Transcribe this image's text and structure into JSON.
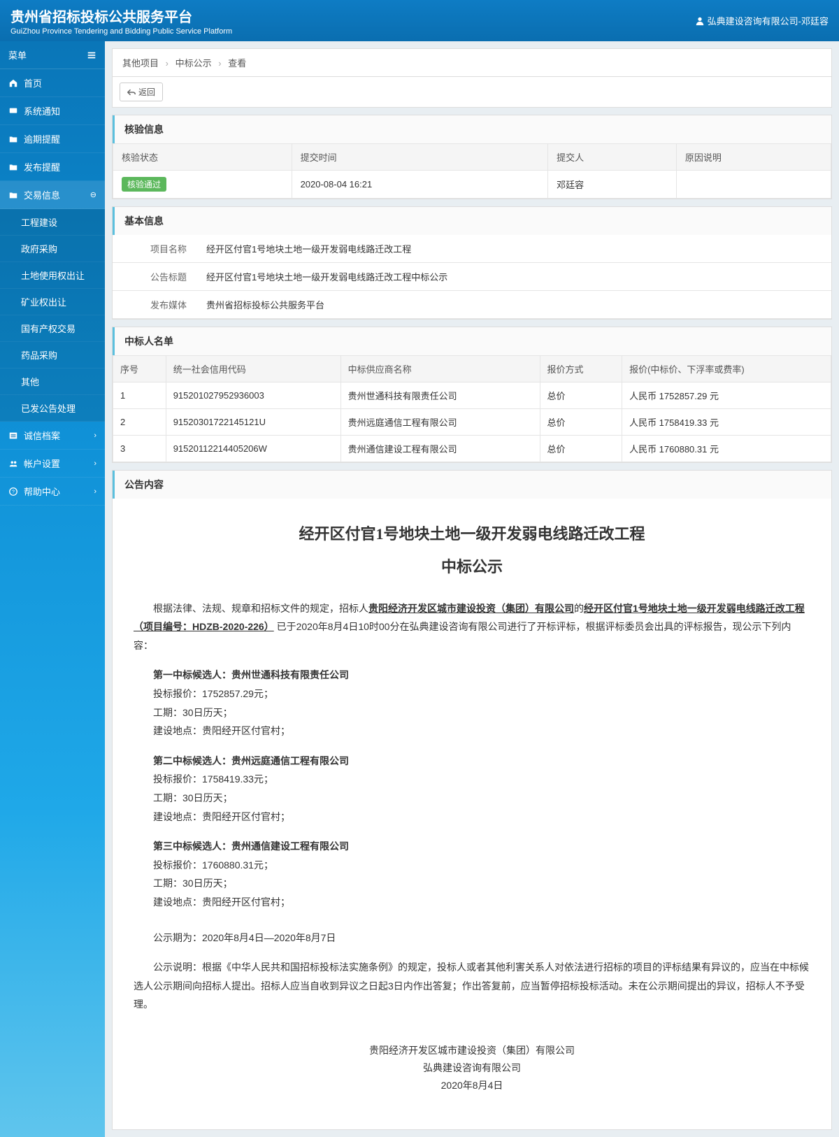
{
  "header": {
    "title": "贵州省招标投标公共服务平台",
    "subtitle": "GuiZhou Province Tendering and Bidding Public Service Platform",
    "user": "弘典建设咨询有限公司-邓廷容"
  },
  "sidebar": {
    "menu_label": "菜单",
    "items": [
      {
        "label": "首页"
      },
      {
        "label": "系统通知"
      },
      {
        "label": "逾期提醒"
      },
      {
        "label": "发布提醒"
      },
      {
        "label": "交易信息",
        "active": true,
        "expanded": true,
        "children": [
          {
            "label": "工程建设"
          },
          {
            "label": "政府采购"
          },
          {
            "label": "土地使用权出让"
          },
          {
            "label": "矿业权出让"
          },
          {
            "label": "国有产权交易"
          },
          {
            "label": "药品采购"
          },
          {
            "label": "其他"
          },
          {
            "label": "已发公告处理"
          }
        ]
      },
      {
        "label": "诚信档案"
      },
      {
        "label": "帐户设置"
      },
      {
        "label": "帮助中心"
      }
    ]
  },
  "breadcrumb": [
    "其他项目",
    "中标公示",
    "查看"
  ],
  "back_label": "返回",
  "verify": {
    "title": "核验信息",
    "headers": [
      "核验状态",
      "提交时间",
      "提交人",
      "原因说明"
    ],
    "row": {
      "status": "核验通过",
      "time": "2020-08-04 16:21",
      "person": "邓廷容",
      "reason": ""
    }
  },
  "basic": {
    "title": "基本信息",
    "rows": [
      {
        "label": "项目名称",
        "value": "经开区付官1号地块土地一级开发弱电线路迁改工程"
      },
      {
        "label": "公告标题",
        "value": "经开区付官1号地块土地一级开发弱电线路迁改工程中标公示"
      },
      {
        "label": "发布媒体",
        "value": "贵州省招标投标公共服务平台"
      }
    ]
  },
  "bidders": {
    "title": "中标人名单",
    "headers": [
      "序号",
      "统一社会信用代码",
      "中标供应商名称",
      "报价方式",
      "报价(中标价、下浮率或费率)"
    ],
    "rows": [
      {
        "no": "1",
        "code": "915201027952936003",
        "name": "贵州世通科技有限责任公司",
        "method": "总价",
        "price": "人民币 1752857.29 元"
      },
      {
        "no": "2",
        "code": "91520301722145121U",
        "name": "贵州远庭通信工程有限公司",
        "method": "总价",
        "price": "人民币 1758419.33 元"
      },
      {
        "no": "3",
        "code": "91520112214405206W",
        "name": "贵州通信建设工程有限公司",
        "method": "总价",
        "price": "人民币 1760880.31 元"
      }
    ]
  },
  "announce": {
    "panel_title": "公告内容",
    "title": "经开区付官1号地块土地一级开发弱电线路迁改工程",
    "subtitle": "中标公示",
    "para1_pre": "根据法律、法规、规章和招标文件的规定，招标人",
    "para1_u1": "贵阳经济开发区城市建设投资（集团）有限公司",
    "para1_mid": "的",
    "para1_u2": "经开区付官1号地块土地一级开发弱电线路迁改工程（项目编号：HDZB-2020-226）",
    "para1_post": " 已于2020年8月4日10时00分在弘典建设咨询有限公司进行了开标评标，根据评标委员会出具的评标报告，现公示下列内容：",
    "candidates": [
      {
        "title": "第一中标候选人：贵州世通科技有限责任公司",
        "price": "投标报价：1752857.29元；",
        "duration": "工期：30日历天；",
        "location": "建设地点：贵阳经开区付官村；"
      },
      {
        "title": "第二中标候选人：贵州远庭通信工程有限公司",
        "price": "投标报价：1758419.33元；",
        "duration": "工期：30日历天；",
        "location": "建设地点：贵阳经开区付官村；"
      },
      {
        "title": "第三中标候选人：贵州通信建设工程有限公司",
        "price": "投标报价：1760880.31元；",
        "duration": "工期：30日历天；",
        "location": "建设地点：贵阳经开区付官村；"
      }
    ],
    "period": "公示期为：2020年8月4日—2020年8月7日",
    "explain": "公示说明：根据《中华人民共和国招标投标法实施条例》的规定，投标人或者其他利害关系人对依法进行招标的项目的评标结果有异议的，应当在中标候选人公示期间向招标人提出。招标人应当自收到异议之日起3日内作出答复；作出答复前，应当暂停招标投标活动。未在公示期间提出的异议，招标人不予受理。",
    "sign1": "贵阳经济开发区城市建设投资（集团）有限公司",
    "sign2": "弘典建设咨询有限公司",
    "sign_date": "2020年8月4日"
  }
}
